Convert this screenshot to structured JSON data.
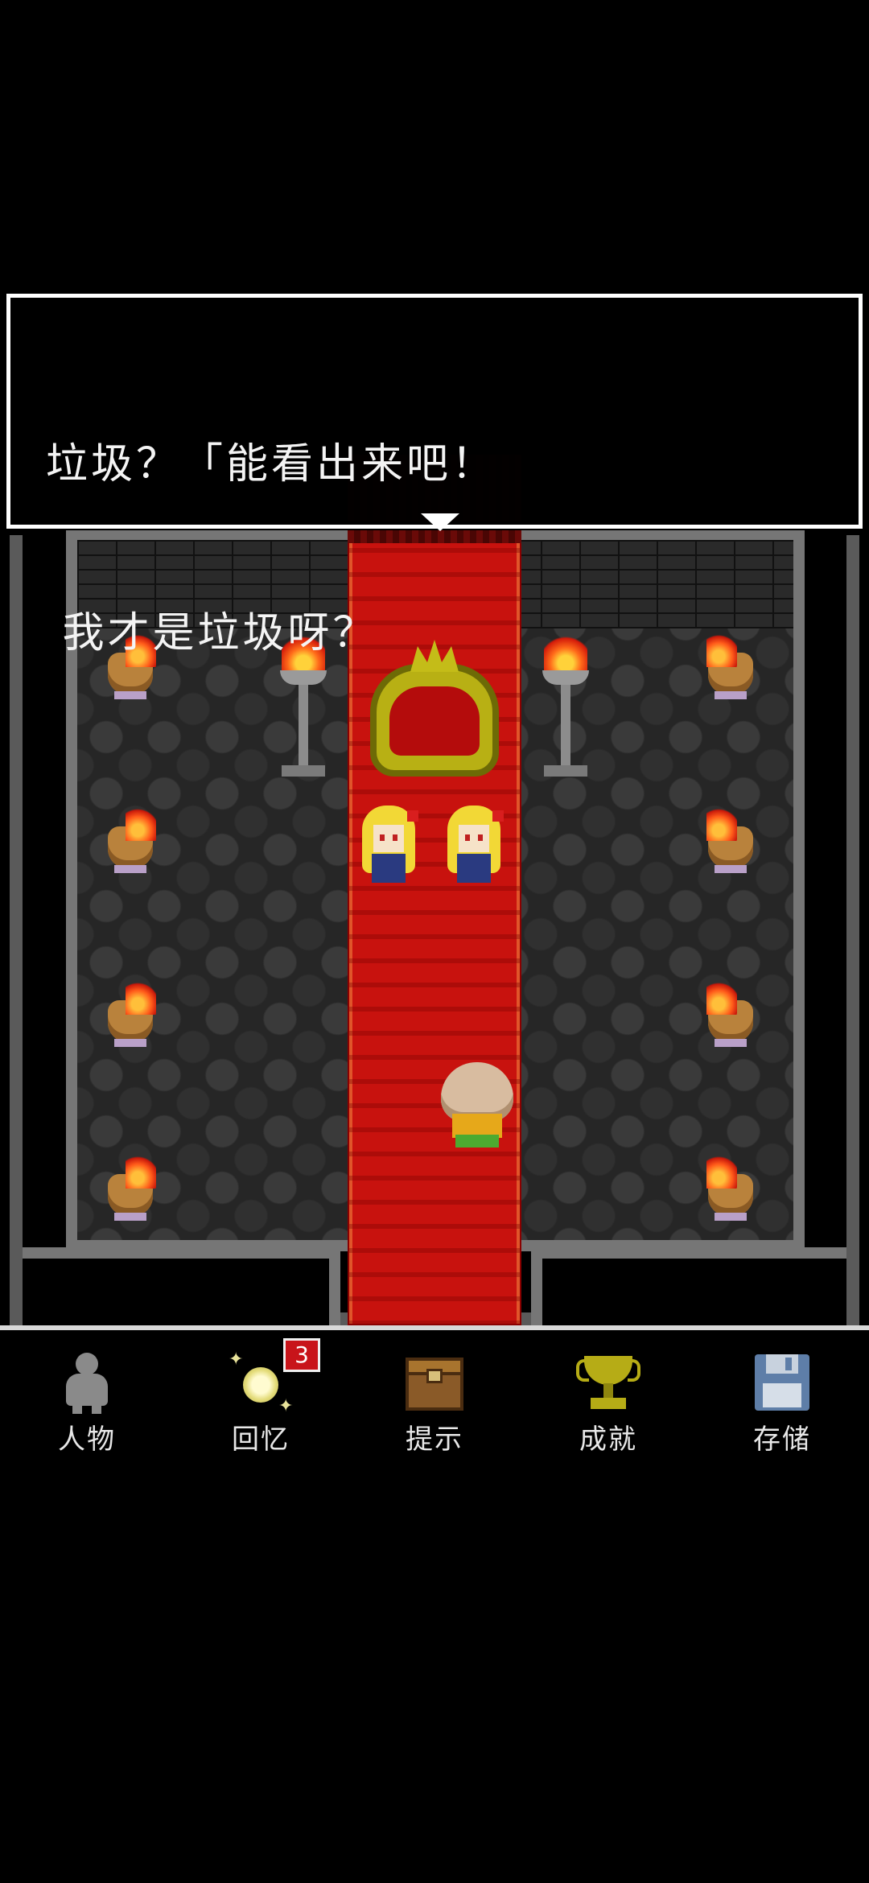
{
  "dialog": {
    "line1": "垃圾？「能看出来吧！",
    "line2": " 我才是垃圾呀？",
    "advance_icon": "triangle-down-icon"
  },
  "menu": {
    "items": [
      {
        "label": "人物",
        "icon": "person-silhouette-icon"
      },
      {
        "label": "回忆",
        "icon": "memory-orb-icon",
        "badge": "3"
      },
      {
        "label": "提示",
        "icon": "treasure-chest-icon"
      },
      {
        "label": "成就",
        "icon": "trophy-icon"
      },
      {
        "label": "存储",
        "icon": "floppy-disk-icon"
      }
    ]
  },
  "colors": {
    "carpet": "#c8120e",
    "badge": "#c8141a",
    "dialog_border": "#ffffff",
    "throne_gold": "#b8b014"
  }
}
